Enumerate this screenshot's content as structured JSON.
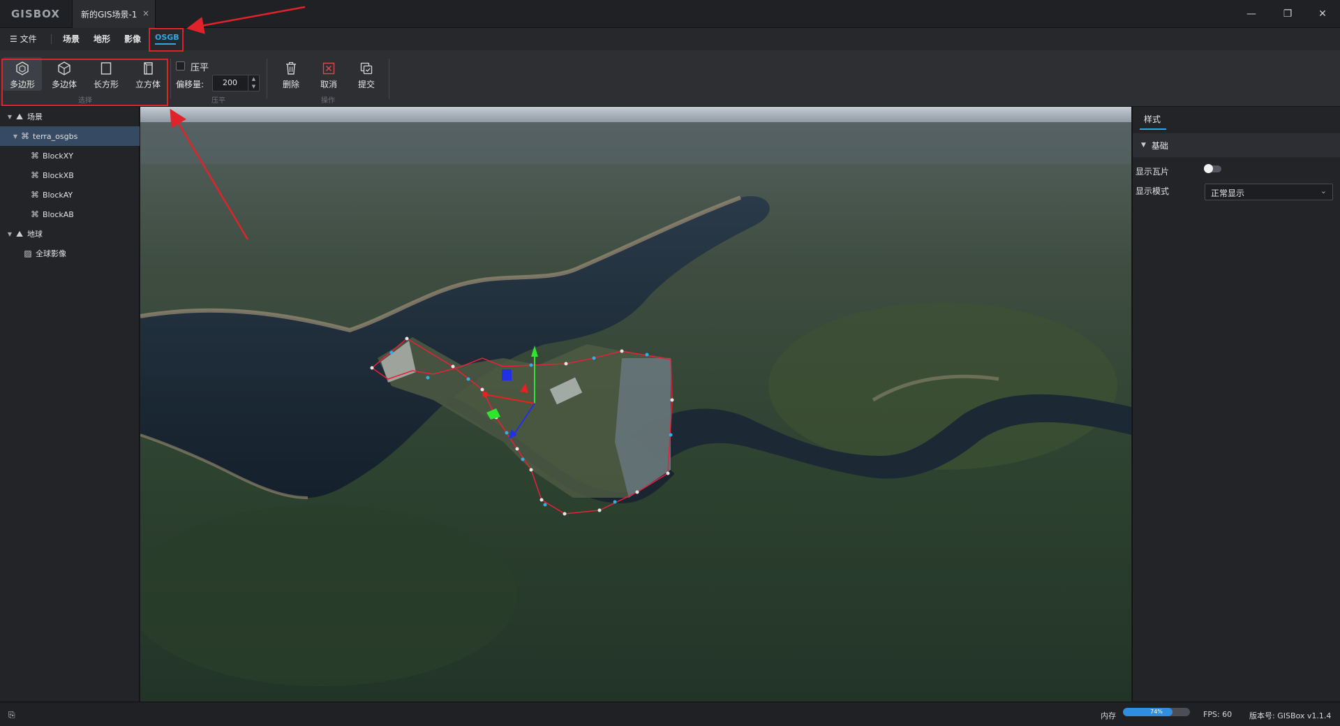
{
  "app": {
    "logo": "GISBOX",
    "document_tab": "新的GIS场景-1",
    "tab_close": "×"
  },
  "window_controls": {
    "minimize": "—",
    "maximize": "❐",
    "close": "✕"
  },
  "menu": {
    "file": "☰ 文件",
    "items": [
      "场景",
      "地形",
      "影像",
      "OSGB"
    ],
    "active": "OSGB"
  },
  "toolbar": {
    "select_group": {
      "label": "选择",
      "buttons": [
        {
          "label": "多边形",
          "icon": "hexagon-icon",
          "active": true
        },
        {
          "label": "多边体",
          "icon": "polyhedron-icon"
        },
        {
          "label": "长方形",
          "icon": "rectangle-icon"
        },
        {
          "label": "立方体",
          "icon": "cube-icon"
        }
      ]
    },
    "flatten_group": {
      "label": "压平",
      "checkbox_label": "压平",
      "checked": false,
      "offset_label": "偏移量:",
      "offset_value": "200"
    },
    "operation_group": {
      "label": "操作",
      "buttons": [
        {
          "label": "删除",
          "icon": "trash-icon"
        },
        {
          "label": "取消",
          "icon": "cancel-icon"
        },
        {
          "label": "提交",
          "icon": "submit-icon"
        }
      ]
    }
  },
  "tree": [
    {
      "label": "场景",
      "icon": "scene-icon",
      "expanded": true,
      "level": 0
    },
    {
      "label": "terra_osgbs",
      "icon": "model-icon",
      "expanded": true,
      "level": 1,
      "selected": true
    },
    {
      "label": "BlockXY",
      "icon": "block-icon",
      "level": 2
    },
    {
      "label": "BlockXB",
      "icon": "block-icon",
      "level": 2
    },
    {
      "label": "BlockAY",
      "icon": "block-icon",
      "level": 2
    },
    {
      "label": "BlockAB",
      "icon": "block-icon",
      "level": 2
    },
    {
      "label": "地球",
      "icon": "globe-icon",
      "expanded": true,
      "level": 0
    },
    {
      "label": "全球影像",
      "icon": "imagery-icon",
      "level": 1
    }
  ],
  "properties": {
    "tab": "样式",
    "section": "基础",
    "show_tiles_label": "显示瓦片",
    "show_tiles": false,
    "display_mode_label": "显示模式",
    "display_mode_value": "正常显示"
  },
  "status": {
    "memory_label": "内存",
    "memory_percent": "74%",
    "memory_fraction": 0.74,
    "fps": "FPS: 60",
    "version": "版本号: GISBox v1.1.4"
  },
  "colors": {
    "accent": "#2fa8e6",
    "annotation": "#e0232a",
    "selection_edge": "#e8203a"
  }
}
